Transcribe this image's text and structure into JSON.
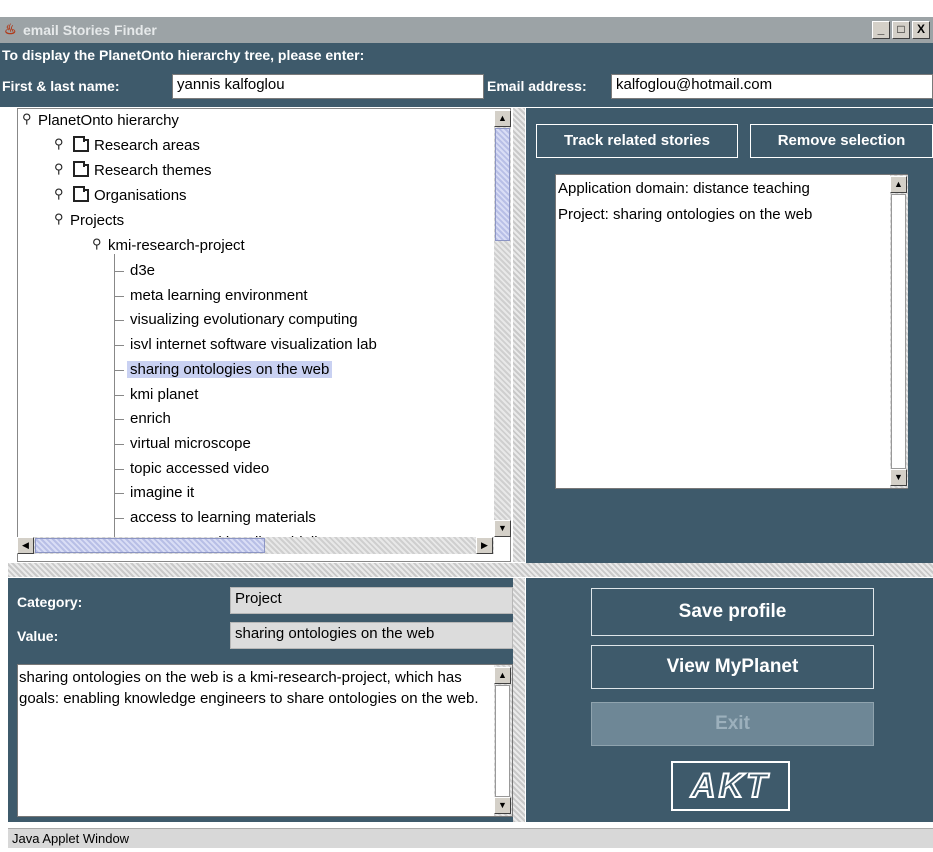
{
  "window": {
    "title": "email Stories Finder",
    "minimize_glyph": "_",
    "maximize_glyph": "□",
    "close_glyph": "X"
  },
  "header": {
    "prompt": "To display the PlanetOnto hierarchy tree, please enter:",
    "name_label": "First & last name:",
    "name_value": "yannis kalfoglou",
    "email_label": "Email address:",
    "email_value": "kalfoglou@hotmail.com"
  },
  "tree": {
    "root": "PlanetOnto hierarchy",
    "folders": [
      "Research areas",
      "Research themes",
      "Organisations"
    ],
    "projects": "Projects",
    "subgroup": "kmi-research-project",
    "items": [
      "d3e",
      "meta learning environment",
      "visualizing evolutionary computing",
      "isvl internet software visualization lab",
      "sharing ontologies on the web",
      "kmi planet",
      "enrich",
      "virtual microscope",
      "topic accessed video",
      "imagine it",
      "access to learning materials",
      "access to multimedia guidelines"
    ],
    "selected_index": 4
  },
  "right_panel": {
    "track_button": "Track related stories",
    "remove_button": "Remove selection",
    "selections": [
      "Application domain: distance teaching",
      "Project: sharing ontologies on the web"
    ]
  },
  "details": {
    "category_label": "Category:",
    "category_value": "Project",
    "value_label": "Value:",
    "value_value": "sharing ontologies on the web",
    "description": "sharing ontologies on the web is a  kmi-research-project, which has goals:  enabling knowledge engineers to share ontologies on the web."
  },
  "actions": {
    "save_profile": "Save profile",
    "view_myplanet": "View MyPlanet",
    "exit": "Exit",
    "logo_text": "AKT"
  },
  "status_bar": "Java Applet Window",
  "colors": {
    "panel_dark": "#3e5a6b",
    "selection": "#c9d1f2",
    "titlebar": "#9ca3a6"
  }
}
